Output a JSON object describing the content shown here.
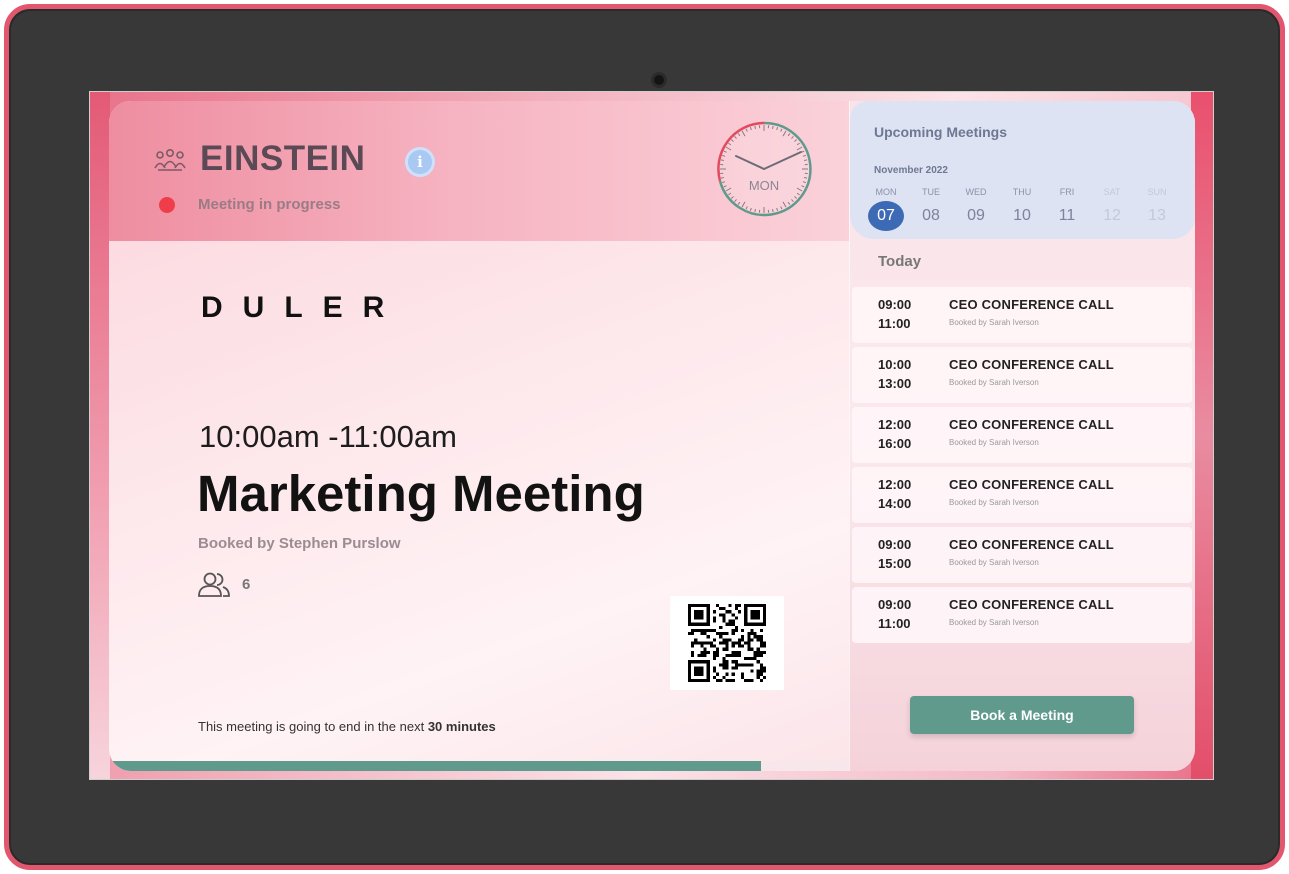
{
  "room": {
    "name": "EINSTEIN",
    "status": "Meeting in progress",
    "status_color": "#ef3e4a",
    "icons": [
      "people-group-icon",
      "info-icon"
    ]
  },
  "clock": {
    "day_label": "MON",
    "hands": "10:10"
  },
  "brand": {
    "text": "DULER"
  },
  "current_meeting": {
    "time_range": "10:00am -11:00am",
    "title": "Marketing Meeting",
    "booked_by": "Booked by Stephen Purslow",
    "attendees": "6",
    "end_note_prefix": "This meeting is going to end in the next",
    "end_note_emphasis": "30 minutes",
    "progress_fraction": 0.6
  },
  "upcoming": {
    "title": "Upcoming Meetings",
    "month": "November 2022",
    "days": [
      {
        "name": "MON",
        "num": "07",
        "state": "active"
      },
      {
        "name": "TUE",
        "num": "08",
        "state": "normal"
      },
      {
        "name": "WED",
        "num": "09",
        "state": "normal"
      },
      {
        "name": "THU",
        "num": "10",
        "state": "normal"
      },
      {
        "name": "FRI",
        "num": "11",
        "state": "normal"
      },
      {
        "name": "SAT",
        "num": "12",
        "state": "dim"
      },
      {
        "name": "SUN",
        "num": "13",
        "state": "dim"
      }
    ],
    "today_label": "Today",
    "meetings": [
      {
        "start": "09:00",
        "end": "11:00",
        "title": "CEO CONFERENCE CALL",
        "booker": "Booked by Sarah Iverson"
      },
      {
        "start": "10:00",
        "end": "13:00",
        "title": "CEO CONFERENCE CALL",
        "booker": "Booked by Sarah Iverson"
      },
      {
        "start": "12:00",
        "end": "16:00",
        "title": "CEO CONFERENCE CALL",
        "booker": "Booked by Sarah Iverson"
      },
      {
        "start": "12:00",
        "end": "14:00",
        "title": "CEO CONFERENCE CALL",
        "booker": "Booked by Sarah Iverson"
      },
      {
        "start": "09:00",
        "end": "15:00",
        "title": "CEO CONFERENCE CALL",
        "booker": "Booked by Sarah Iverson"
      },
      {
        "start": "09:00",
        "end": "11:00",
        "title": "CEO CONFERENCE CALL",
        "booker": "Booked by Sarah Iverson"
      }
    ],
    "book_button": "Book a Meeting"
  },
  "colors": {
    "accent_teal": "#5f9a8d",
    "selected_day": "#3d6ab5",
    "device_bezel": "#383838",
    "device_frame": "#e2566e"
  }
}
